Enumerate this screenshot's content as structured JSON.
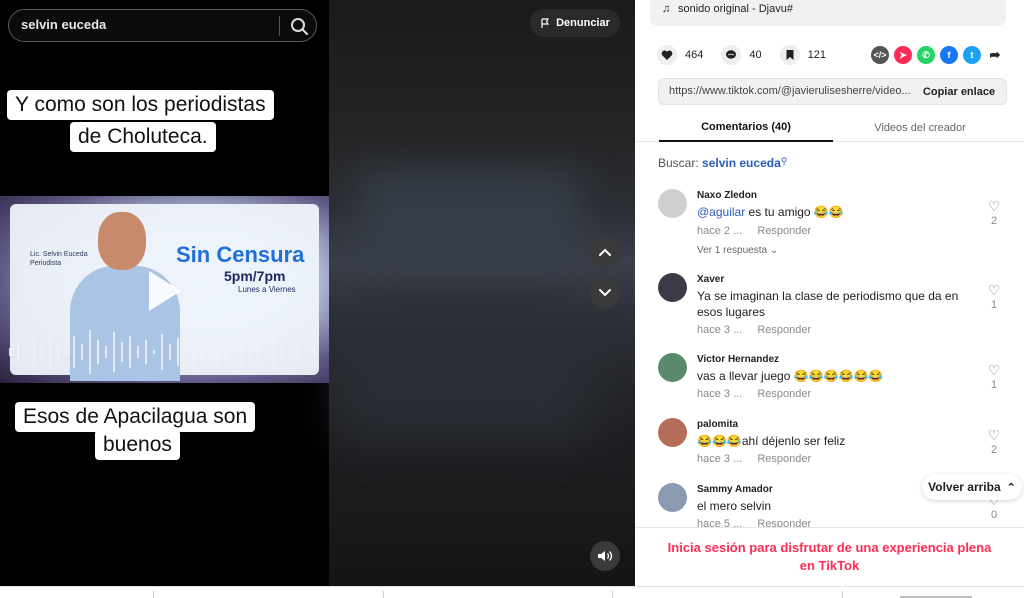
{
  "search": {
    "query": "selvin euceda",
    "icon": "search-icon"
  },
  "report": {
    "label": "Denunciar",
    "icon": "flag-icon"
  },
  "video": {
    "caption_top_line1": "Y como son los periodistas",
    "caption_top_line2": "de Choluteca.",
    "caption_bottom_line1": "Esos de Apacilagua son",
    "caption_bottom_line2": "buenos",
    "thumb_name": "Lic. Selvin Euceda",
    "thumb_role": "Periodista",
    "thumb_show": "Sin Censura",
    "thumb_time": "5pm/7pm",
    "thumb_days": "Lunes a Viernes"
  },
  "sound": {
    "label": "sonido original - Djavu#"
  },
  "actions": {
    "likes": "464",
    "comments": "40",
    "saves": "121"
  },
  "share_colors": {
    "embed": "#555555",
    "send": "#fe2c55",
    "whatsapp": "#25d366",
    "facebook": "#1877f2",
    "twitter": "#1da1f2"
  },
  "link": {
    "url": "https://www.tiktok.com/@javierulisesherre/video...",
    "copy_label": "Copiar enlace"
  },
  "tabs": {
    "comments": "Comentarios (40)",
    "creator_videos": "Videos del creador"
  },
  "buscar": {
    "label": "Buscar:",
    "term": "selvin euceda"
  },
  "comments": [
    {
      "user": "Naxo Zledon",
      "mention": "@aguilar",
      "text": " es tu amigo 😂😂",
      "time": "hace 2 ...",
      "reply": "Responder",
      "likes": "2",
      "view_replies": "Ver 1 respuesta"
    },
    {
      "user": "Xaver",
      "text": "Ya se imaginan la clase de periodismo que da en esos lugares",
      "time": "hace 3 ...",
      "reply": "Responder",
      "likes": "1"
    },
    {
      "user": "Victor Hernandez",
      "text": "vas a llevar juego 😂😂😂😂😂😂",
      "time": "hace 3 ...",
      "reply": "Responder",
      "likes": "1"
    },
    {
      "user": "palomita",
      "text": "😂😂😂ahí déjenlo ser feliz",
      "time": "hace 3 ...",
      "reply": "Responder",
      "likes": "2"
    },
    {
      "user": "Sammy Amador",
      "text": "el mero selvin ",
      "time": "hace 5 ...",
      "reply": "Responder",
      "likes": "0"
    }
  ],
  "back_top": {
    "label": "Volver arriba"
  },
  "login_prompt": {
    "text": "Inicia sesión para disfrutar de una experiencia plena en TikTok"
  }
}
